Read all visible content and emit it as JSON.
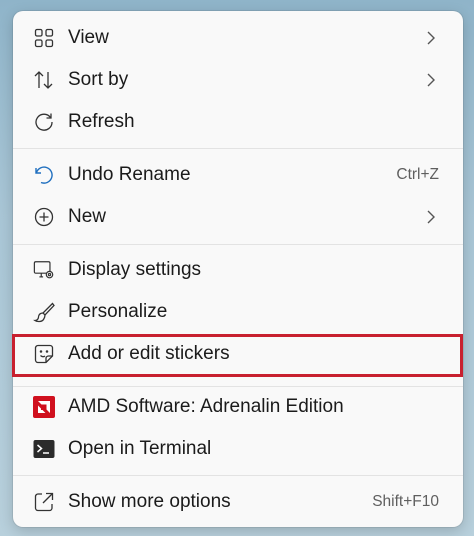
{
  "menu": {
    "items": [
      {
        "label": "View",
        "icon": "grid-icon",
        "has_submenu": true
      },
      {
        "label": "Sort by",
        "icon": "sort-icon",
        "has_submenu": true
      },
      {
        "label": "Refresh",
        "icon": "refresh-icon",
        "has_submenu": false
      },
      {
        "label": "Undo Rename",
        "icon": "undo-icon",
        "shortcut": "Ctrl+Z"
      },
      {
        "label": "New",
        "icon": "plus-circle-icon",
        "has_submenu": true
      },
      {
        "label": "Display settings",
        "icon": "display-icon"
      },
      {
        "label": "Personalize",
        "icon": "brush-icon"
      },
      {
        "label": "Add or edit stickers",
        "icon": "sticker-icon",
        "highlighted": true
      },
      {
        "label": "AMD Software: Adrenalin Edition",
        "icon": "amd-logo-icon"
      },
      {
        "label": "Open in Terminal",
        "icon": "terminal-icon"
      },
      {
        "label": "Show more options",
        "icon": "share-icon",
        "shortcut": "Shift+F10"
      }
    ]
  },
  "colors": {
    "highlight_border": "#c8202f",
    "accent_blue": "#1f6fbf",
    "amd_red": "#d0101e"
  }
}
